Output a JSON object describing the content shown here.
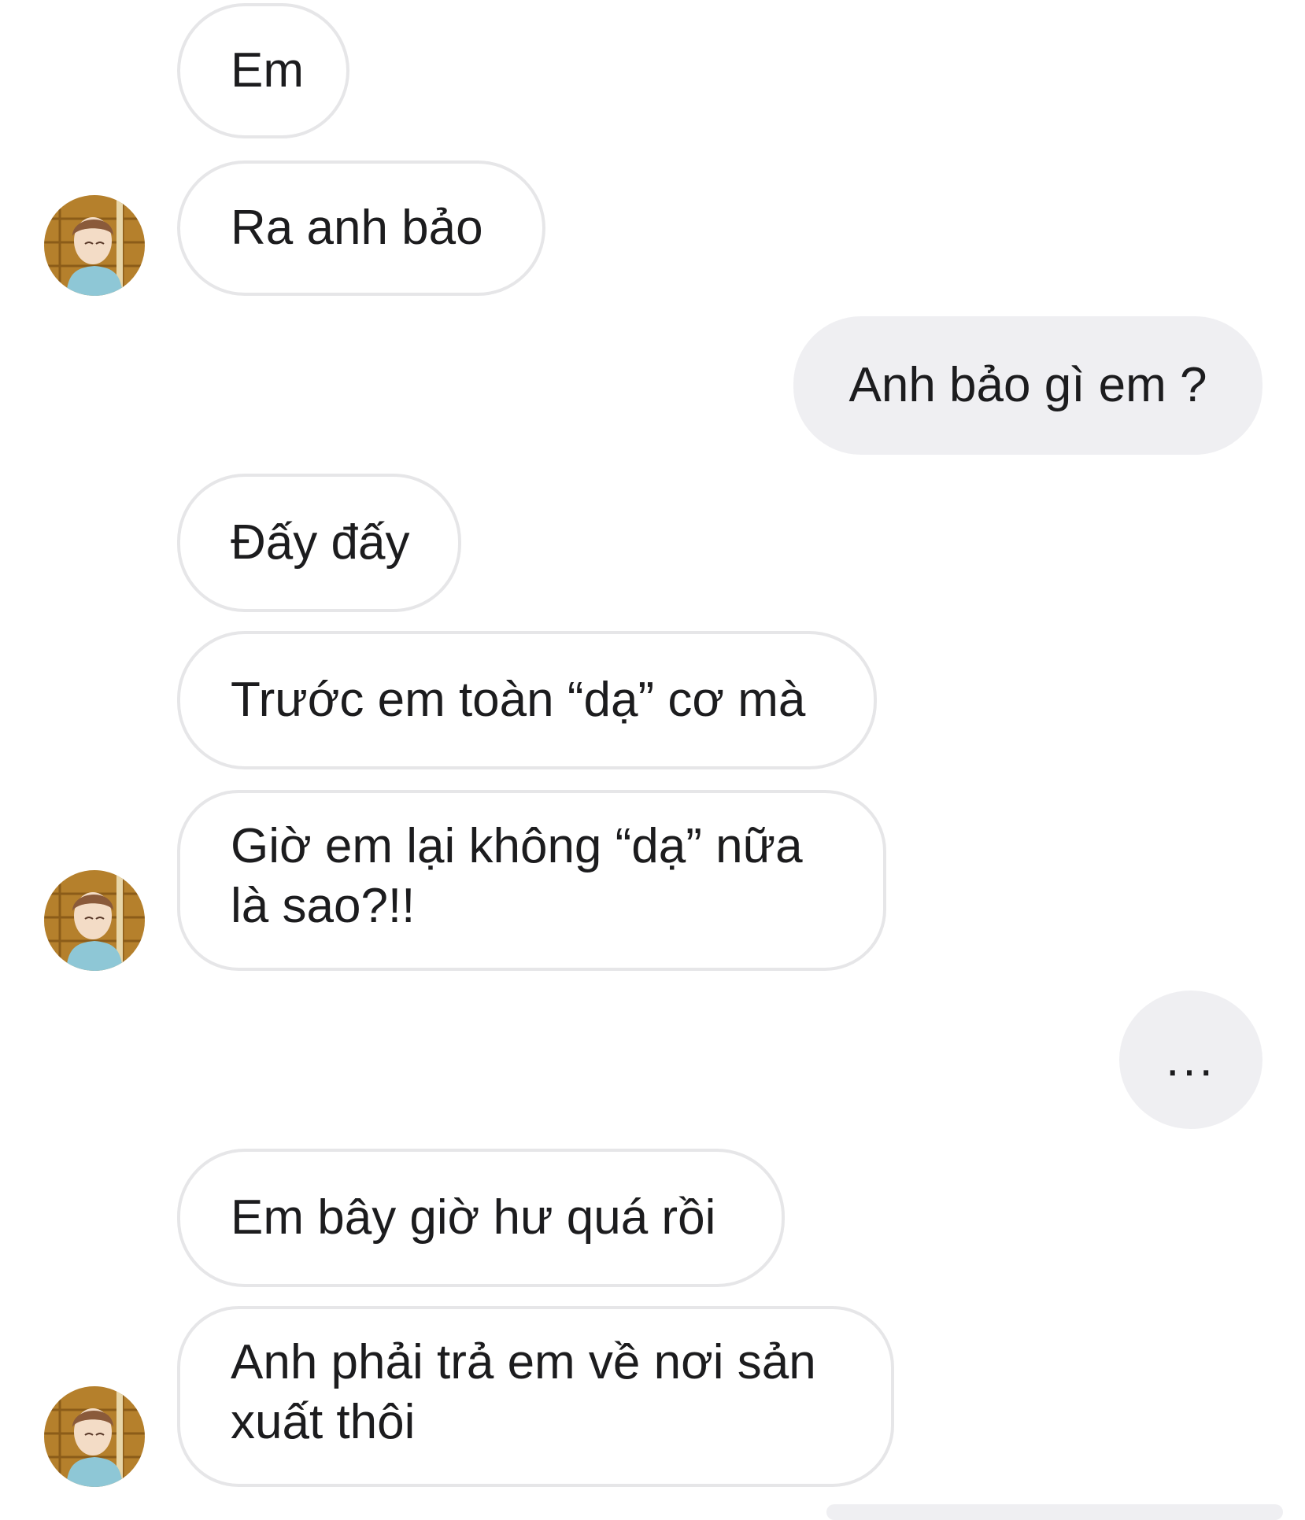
{
  "conversation": {
    "messages": [
      {
        "sender": "them",
        "text": "Em"
      },
      {
        "sender": "them",
        "text": "Ra anh bảo"
      },
      {
        "sender": "me",
        "text": "Anh bảo gì em ?"
      },
      {
        "sender": "them",
        "text": "Đấy đấy"
      },
      {
        "sender": "them",
        "text": "Trước em toàn “dạ” cơ mà"
      },
      {
        "sender": "them",
        "line1": "Giờ em lại không “dạ” nữa",
        "line2": "là sao?!!"
      },
      {
        "sender": "me",
        "text": "..."
      },
      {
        "sender": "them",
        "text": "Em bây giờ hư quá rồi"
      },
      {
        "sender": "them",
        "line1": "Anh phải trả em về nơi sản",
        "line2": "xuất thôi"
      }
    ]
  },
  "colors": {
    "incoming_border": "#e6e6e8",
    "outgoing_background": "#efeff2",
    "text": "#1c1c1e"
  },
  "icons": {
    "avatar": "contact-avatar-icon"
  }
}
